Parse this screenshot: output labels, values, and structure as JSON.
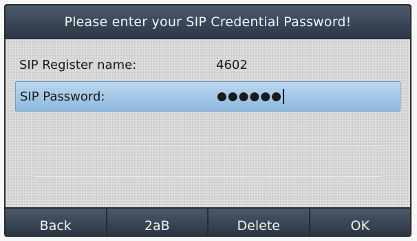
{
  "title": "Please enter your SIP Credential Password!",
  "fields": [
    {
      "label": "SIP Register name:",
      "value": "4602"
    },
    {
      "label": "SIP Password:",
      "value": "●●●●●●"
    }
  ],
  "softkeys": [
    "Back",
    "2aB",
    "Delete",
    "OK"
  ],
  "colors": {
    "titlebar": "#3a4756",
    "content_bg": "#d6d6d6",
    "selected_row": "#a9cbea",
    "softkey": "#3a4756"
  }
}
